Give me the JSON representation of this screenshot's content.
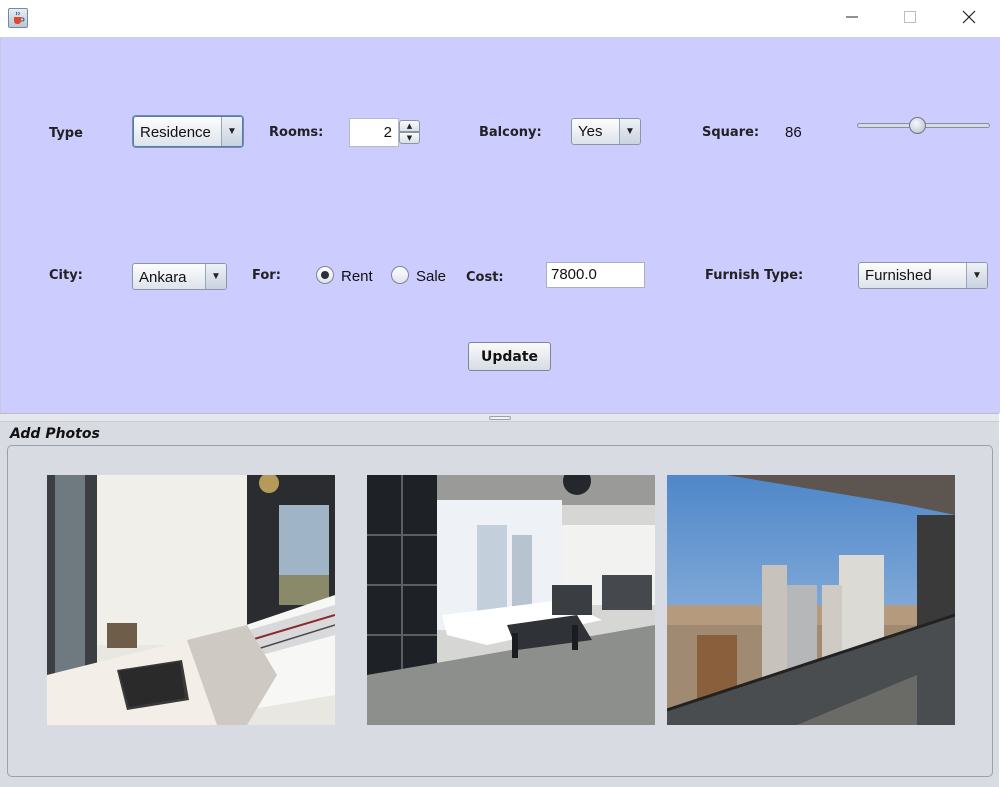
{
  "window": {
    "icons": {
      "app": "java-cup-icon",
      "minimize": "minimize-icon",
      "maximize": "maximize-icon",
      "close": "close-icon"
    }
  },
  "form": {
    "type_label": "Type",
    "type_value": "Residence",
    "rooms_label": "Rooms:",
    "rooms_value": "2",
    "balcony_label": "Balcony:",
    "balcony_value": "Yes",
    "square_label": "Square:",
    "square_value": "86",
    "square_slider_fraction": 0.45,
    "city_label": "City:",
    "city_value": "Ankara",
    "for_label": "For:",
    "for_options": [
      {
        "label": "Rent",
        "checked": true
      },
      {
        "label": "Sale",
        "checked": false
      }
    ],
    "cost_label": "Cost:",
    "cost_value": "7800.0",
    "furnish_label": "Furnish Type:",
    "furnish_value": "Furnished",
    "update_label": "Update"
  },
  "photos": {
    "title": "Add Photos",
    "items": [
      "bedroom-photo",
      "living-room-photo",
      "balcony-view-photo"
    ]
  },
  "colors": {
    "top_panel": "#ccccff",
    "bottom_panel": "#d8dbe1"
  }
}
